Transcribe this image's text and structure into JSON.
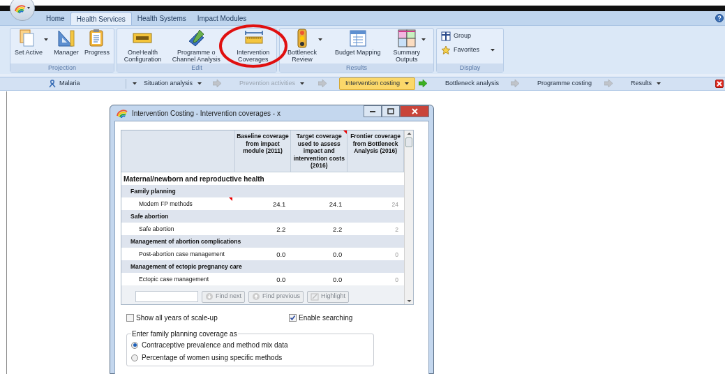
{
  "ribbon_tabs": [
    {
      "label": "Home",
      "selected": false
    },
    {
      "label": "Health Services",
      "selected": true
    },
    {
      "label": "Health Systems",
      "selected": false
    },
    {
      "label": "Impact Modules",
      "selected": false
    }
  ],
  "ribbon_groups": [
    {
      "title": "Projection",
      "buttons": [
        {
          "label": "Set Active",
          "dropdown": true
        },
        {
          "label": "Manager",
          "dropdown": false
        },
        {
          "label": "Progress",
          "dropdown": false
        }
      ]
    },
    {
      "title": "Edit",
      "buttons": [
        {
          "label": "OneHealth\nConfiguration",
          "dropdown": false,
          "circled": false
        },
        {
          "label": "Programme o\nChannel Analysis",
          "dropdown": false,
          "circled": false
        },
        {
          "label": "Intervention\nCoverages",
          "dropdown": false,
          "circled": true
        }
      ]
    },
    {
      "title": "Results",
      "buttons": [
        {
          "label": "Bottleneck\nReview",
          "dropdown": true
        },
        {
          "label": "Budget Mapping",
          "dropdown": false
        },
        {
          "label": "Summary\nOutputs",
          "dropdown": true
        }
      ]
    },
    {
      "title": "Display",
      "small_buttons": [
        {
          "label": "Group",
          "dropdown": false
        },
        {
          "label": "Favorites",
          "dropdown": true
        }
      ]
    }
  ],
  "workflow": [
    {
      "label": "Malaria",
      "dropdown": true,
      "selected": false,
      "disabled": false
    },
    {
      "label": "Situation analysis",
      "dropdown": true,
      "selected": false,
      "disabled": false
    },
    {
      "label": "Prevention activities",
      "dropdown": true,
      "selected": false,
      "disabled": true
    },
    {
      "label": "Intervention costing",
      "dropdown": true,
      "selected": true,
      "disabled": false
    },
    {
      "label": "Bottleneck analysis",
      "dropdown": false,
      "selected": false,
      "disabled": false
    },
    {
      "label": "Programme costing",
      "dropdown": false,
      "selected": false,
      "disabled": false
    },
    {
      "label": "Results",
      "dropdown": true,
      "selected": false,
      "disabled": false
    }
  ],
  "dialog": {
    "title": "Intervention Costing - Intervention coverages - x",
    "columns": [
      {
        "label": "Baseline coverage from impact module (2011)",
        "comment": false
      },
      {
        "label": "Target coverage used to assess impact and intervention costs (2016)",
        "comment": true
      },
      {
        "label": "Frontier coverage from Bottleneck Analysis (2016)",
        "comment": false
      }
    ],
    "rows": [
      {
        "kind": "section",
        "label": "Maternal/newborn and reproductive health"
      },
      {
        "kind": "group",
        "label": "Family planning"
      },
      {
        "kind": "item",
        "label": "Modern FP methods",
        "comment": true,
        "values": [
          "24.1",
          "24.1",
          "24"
        ]
      },
      {
        "kind": "group",
        "label": "Safe abortion"
      },
      {
        "kind": "item",
        "label": "Safe abortion",
        "comment": false,
        "values": [
          "2.2",
          "2.2",
          "2"
        ]
      },
      {
        "kind": "group",
        "label": "Management of abortion complications"
      },
      {
        "kind": "item",
        "label": "Post-abortion case management",
        "comment": false,
        "values": [
          "0.0",
          "0.0",
          "0"
        ]
      },
      {
        "kind": "group",
        "label": "Management of ectopic pregnancy care"
      },
      {
        "kind": "item",
        "label": "Ectopic case management",
        "comment": false,
        "values": [
          "0.0",
          "0.0",
          "0"
        ]
      }
    ],
    "search_buttons": [
      {
        "label": "Find next",
        "disabled": true
      },
      {
        "label": "Find previous",
        "disabled": true
      },
      {
        "label": "Highlight",
        "disabled": true
      }
    ],
    "checkboxes": [
      {
        "label": "Show all years of scale-up",
        "checked": false
      },
      {
        "label": "Enable searching",
        "checked": true
      }
    ],
    "radio_group": {
      "legend": "Enter family planning coverage as",
      "options": [
        {
          "label": "Contraceptive prevalence and method mix data",
          "selected": true
        },
        {
          "label": "Percentage of women using specific methods",
          "selected": false
        }
      ]
    }
  }
}
